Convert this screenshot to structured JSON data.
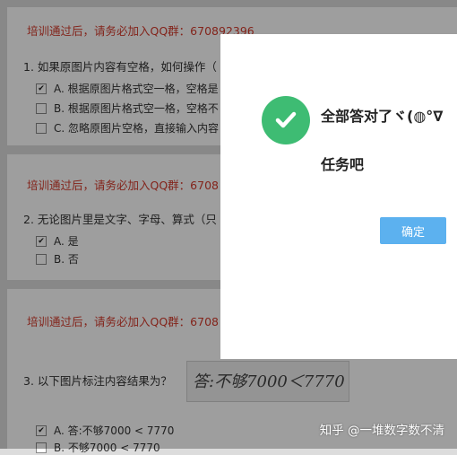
{
  "notice": "培训通过后，请务必加入QQ群：670892396",
  "notice_truncated": "培训通过后，请务必加入QQ群：6708",
  "questions": [
    {
      "text": "1. 如果原图片内容有空格，如何操作（",
      "options": [
        {
          "label": "A. 根据原图片格式空一格，空格是",
          "checked": true
        },
        {
          "label": "B. 根据原图片格式空一格，空格不",
          "checked": false
        },
        {
          "label": "C. 忽略原图片空格，直接输入内容",
          "checked": false
        }
      ]
    },
    {
      "text": "2. 无论图片里是文字、字母、算式（只",
      "options": [
        {
          "label": "A. 是",
          "checked": true
        },
        {
          "label": "B. 否",
          "checked": false
        }
      ]
    },
    {
      "text": "3. 以下图片标注内容结果为？",
      "image_text": "答:不够7000＜7770",
      "options": [
        {
          "label": "A. 答:不够7000 < 7770",
          "checked": true
        },
        {
          "label": "B. 不够7000 < 7770",
          "checked": false
        }
      ]
    }
  ],
  "dialog": {
    "line1": "全部答对了ヾ(◍°∇",
    "line2": "任务吧",
    "confirm_label": "确定",
    "icon": "check-circle-icon",
    "icon_color": "#3ebc73",
    "button_color": "#5cb1ef"
  },
  "watermark": "知乎 @一堆数字数不清"
}
